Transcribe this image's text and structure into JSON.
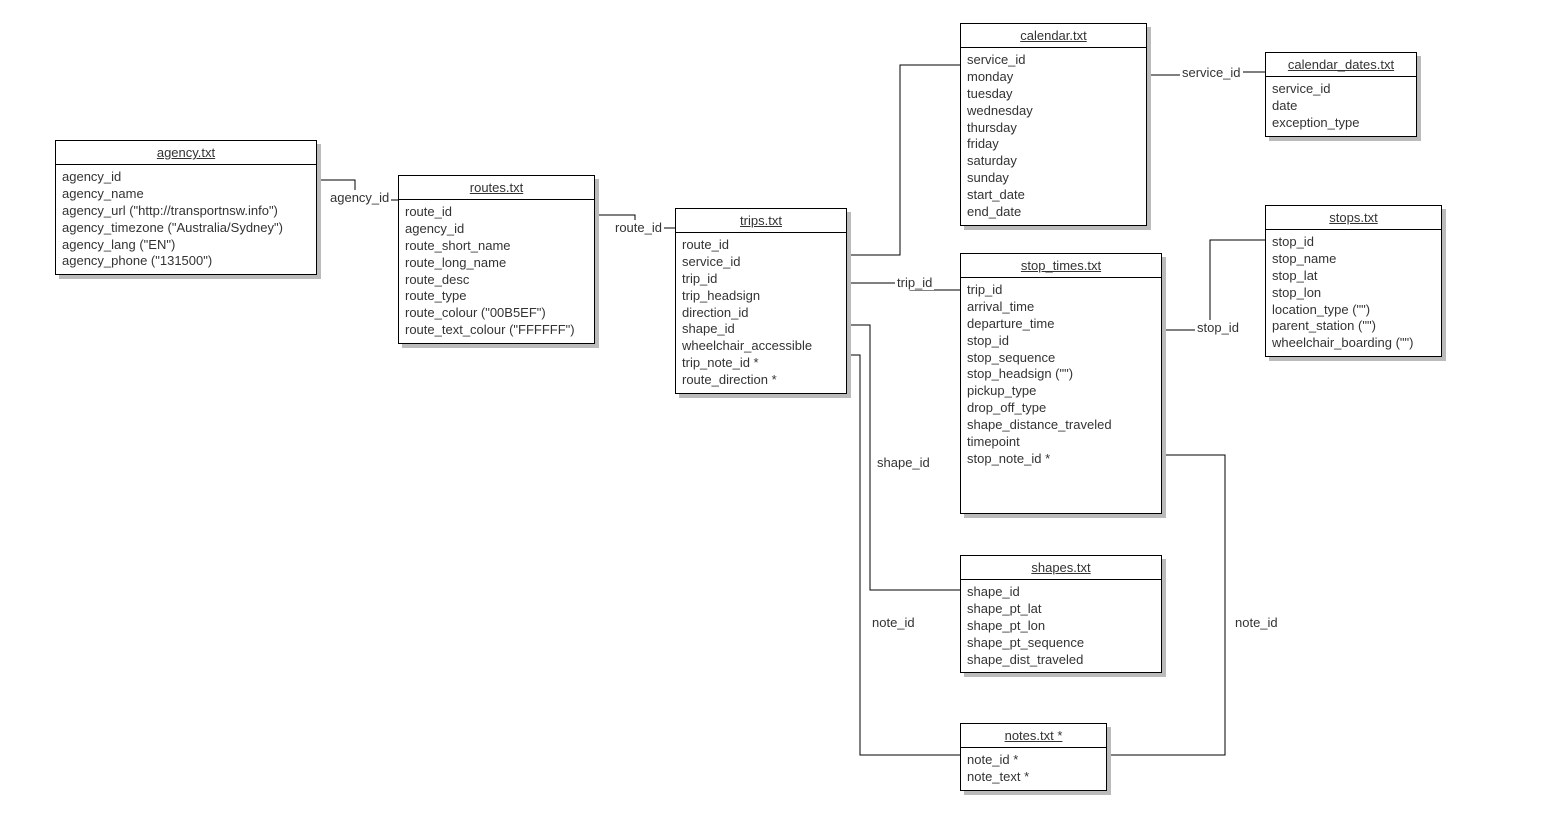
{
  "entities": {
    "agency": {
      "title": "agency.txt",
      "fields": [
        "agency_id",
        "agency_name",
        "agency_url (\"http://transportnsw.info\")",
        "agency_timezone (\"Australia/Sydney\")",
        "agency_lang (\"EN\")",
        "agency_phone (\"131500\")"
      ]
    },
    "routes": {
      "title": "routes.txt",
      "fields": [
        "route_id",
        "agency_id",
        "route_short_name",
        "route_long_name",
        "route_desc",
        "route_type",
        "route_colour (\"00B5EF\")",
        "route_text_colour (\"FFFFFF\")"
      ]
    },
    "trips": {
      "title": "trips.txt",
      "fields": [
        "route_id",
        "service_id",
        "trip_id",
        "trip_headsign",
        "direction_id",
        "shape_id",
        "wheelchair_accessible",
        "trip_note_id *",
        "route_direction *"
      ]
    },
    "calendar": {
      "title": "calendar.txt",
      "fields": [
        "service_id",
        "monday",
        "tuesday",
        "wednesday",
        "thursday",
        "friday",
        "saturday",
        "sunday",
        "start_date",
        "end_date"
      ]
    },
    "calendar_dates": {
      "title": "calendar_dates.txt",
      "fields": [
        "service_id",
        "date",
        "exception_type"
      ]
    },
    "stop_times": {
      "title": "stop_times.txt",
      "fields": [
        "trip_id",
        "arrival_time",
        "departure_time",
        "stop_id",
        "stop_sequence",
        "stop_headsign (\"\")",
        "pickup_type",
        "drop_off_type",
        "shape_distance_traveled",
        "timepoint",
        "stop_note_id *"
      ]
    },
    "stops": {
      "title": "stops.txt",
      "fields": [
        "stop_id",
        "stop_name",
        "stop_lat",
        "stop_lon",
        "location_type (\"\")",
        "parent_station (\"\")",
        "wheelchair_boarding (\"\")"
      ]
    },
    "shapes": {
      "title": "shapes.txt",
      "fields": [
        "shape_id",
        "shape_pt_lat",
        "shape_pt_lon",
        "shape_pt_sequence",
        "shape_dist_traveled"
      ]
    },
    "notes": {
      "title": "notes.txt *",
      "fields": [
        "note_id *",
        "note_text *"
      ]
    }
  },
  "labels": {
    "agency_id": "agency_id",
    "route_id": "route_id",
    "service_id": "service_id",
    "trip_id": "trip_id",
    "stop_id": "stop_id",
    "shape_id": "shape_id",
    "note_id": "note_id"
  }
}
